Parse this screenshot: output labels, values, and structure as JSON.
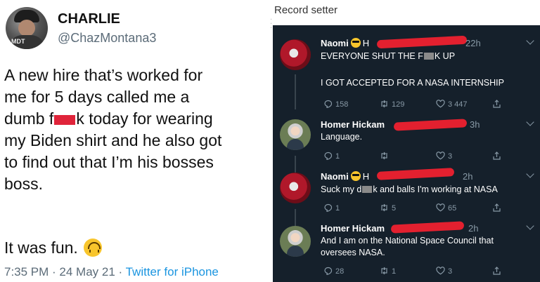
{
  "left_tweet": {
    "name": "CHARLIE",
    "handle": "@ChazMontana3",
    "avatar_text": "MDT",
    "lines": [
      "A new hire that’s worked for",
      "me for 5 days called me a",
      "dumb f",
      "k today for wearing",
      "my Biden shirt and he also got",
      "to find out that I’m his bosses",
      "boss."
    ],
    "closing": "It was fun.",
    "time": "7:35 PM · 24 May 21 · ",
    "source": "Twitter for iPhone"
  },
  "right_panel": {
    "title": "Record setter",
    "tweets": [
      {
        "name": "Naomi",
        "initial": "H",
        "time": "22h",
        "body_1": "EVERYONE SHUT THE F",
        "body_1b": "K UP",
        "body_2": "I GOT ACCEPTED FOR A NASA INTERNSHIP",
        "replies": "158",
        "retweets": "129",
        "likes": "3 447"
      },
      {
        "name": "Homer Hickam",
        "time": "3h",
        "body": "Language.",
        "replies": "1",
        "retweets": "",
        "likes": "3"
      },
      {
        "name": "Naomi",
        "initial": "H",
        "time": "2h",
        "body_1": "Suck my d",
        "body_1b": "k and balls I'm working at NASA",
        "replies": "1",
        "retweets": "5",
        "likes": "65"
      },
      {
        "name": "Homer Hickam",
        "time": "2h",
        "body": "And I am on the National Space Council that oversees NASA.",
        "replies": "28",
        "retweets": "1",
        "likes": "3"
      }
    ]
  },
  "colors": {
    "dark_bg": "#15202b",
    "link_blue": "#1b95e0",
    "redaction_red": "#e3202f"
  }
}
